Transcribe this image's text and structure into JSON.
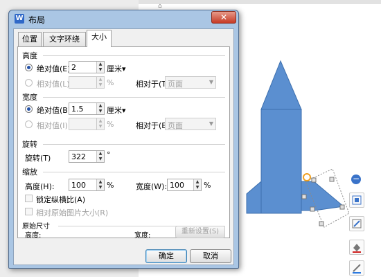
{
  "dialog": {
    "title": "布局",
    "close_glyph": "✕",
    "app_icon_letter": "W",
    "tabs": [
      {
        "label": "位置"
      },
      {
        "label": "文字环绕"
      },
      {
        "label": "大小"
      }
    ],
    "height_section": {
      "label": "高度",
      "absolute_label": "绝对值(E)",
      "absolute_value": "2",
      "unit": "厘米▾",
      "relative_label": "相对值(L)",
      "relative_value": "",
      "percent": "%",
      "relative_to_label": "相对于(T)",
      "relative_to_value": "页面"
    },
    "width_section": {
      "label": "宽度",
      "absolute_label": "绝对值(B)",
      "absolute_value": "1.5",
      "unit": "厘米▾",
      "relative_label": "相对值(I)",
      "relative_value": "",
      "percent": "%",
      "relative_to_label": "相对于(E)",
      "relative_to_value": "页面"
    },
    "rotate_section": {
      "label": "旋转",
      "field_label": "旋转(T)",
      "value": "322",
      "unit": "°"
    },
    "scale_section": {
      "label": "缩放",
      "height_label": "高度(H):",
      "height_value": "100",
      "width_label": "宽度(W):",
      "width_value": "100",
      "percent": "%",
      "lock_aspect_label": "锁定纵横比(A)",
      "relative_original_label": "相对原始图片大小(R)"
    },
    "original_size_section": {
      "label": "原始尺寸",
      "height_label": "高度:",
      "width_label": "宽度:",
      "reset_label": "重新设置(S)"
    },
    "ok_label": "确定",
    "cancel_label": "取消"
  },
  "colors": {
    "rocket_fill": "#5b8fd0",
    "rocket_stroke": "#3c6fae",
    "annotation_red": "#e8231f",
    "rotation_handle": "#f0a020"
  },
  "icons": [
    "app-logo-icon",
    "close-icon",
    "spin-up-icon",
    "spin-down-icon",
    "dropdown-arrow-icon",
    "collapse-icon",
    "layout-options-icon",
    "shape-style-icon",
    "shape-fill-icon",
    "shape-outline-icon"
  ]
}
